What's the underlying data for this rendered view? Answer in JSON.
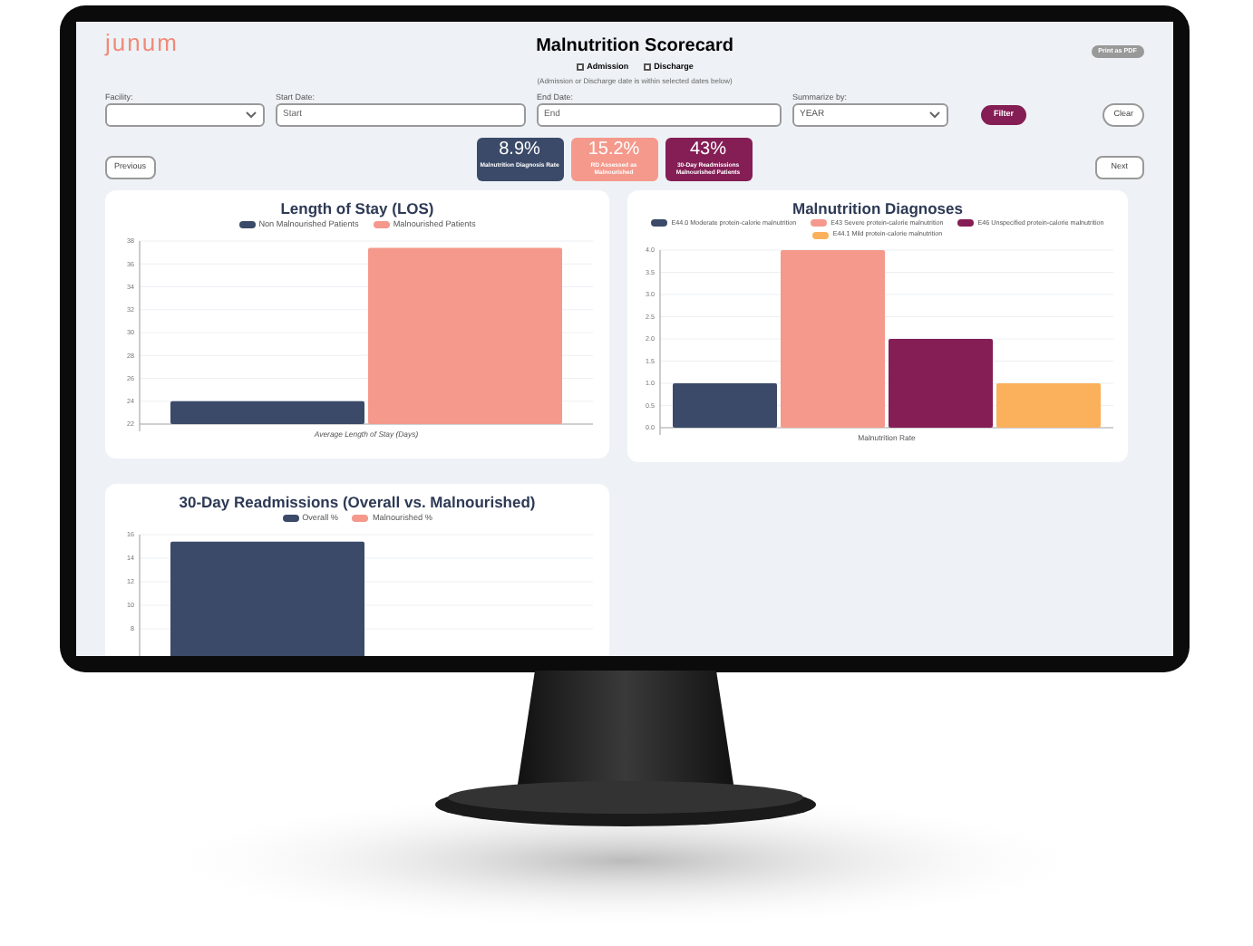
{
  "app": {
    "logo": "junum",
    "title": "Malnutrition Scorecard",
    "print_button": "Print as PDF"
  },
  "date_mode": {
    "options": [
      {
        "label": "Admission",
        "checked": false
      },
      {
        "label": "Discharge",
        "checked": false
      }
    ],
    "note": "(Admission or Discharge date is within selected dates below)"
  },
  "filters": [
    {
      "kind": "select",
      "label": "Facility:"
    },
    {
      "kind": "input",
      "label": "Start Date:",
      "placeholder": "Start"
    },
    {
      "kind": "input",
      "label": "End Date:",
      "placeholder": "End"
    },
    {
      "kind": "select",
      "label": "Summarize by:",
      "value": "YEAR"
    }
  ],
  "filter_button": "Filter",
  "clear_button": "Clear",
  "previous_button": "Previous",
  "next_button": "Next",
  "kpis": [
    {
      "value": "8.9%",
      "label": "Malnutrition Diagnosis Rate",
      "color": "#3b4a68"
    },
    {
      "value": "15.2%",
      "label": "RD Assessed as Malnourished",
      "color": "#f4998c"
    },
    {
      "value": "43%",
      "label": "30-Day Readmissions Malnourished Patients",
      "color": "#841e55"
    }
  ],
  "charts": [
    {
      "title": "Length of Stay (LOS)",
      "chart_data": {
        "type": "bar",
        "categories": [
          "Average Length of Stay (Days)"
        ],
        "ylim": [
          22,
          38
        ],
        "grid": true,
        "yticks": [
          22,
          24,
          26,
          28,
          30,
          32,
          34,
          36,
          38
        ],
        "series": [
          {
            "name": "Non Malnourished Patients",
            "color": "#3b4a68",
            "values": [
              24
            ]
          },
          {
            "name": "Malnourished Patients",
            "color": "#f4998c",
            "values": [
              37.4
            ]
          }
        ]
      }
    },
    {
      "title": "Malnutrition Diagnoses",
      "chart_data": {
        "type": "bar",
        "categories": [
          "Malnutrition Rate"
        ],
        "ylim": [
          0,
          4
        ],
        "grid": true,
        "yticks": [
          {
            "value": 0,
            "label": "0.0"
          },
          0.5,
          {
            "value": 1,
            "label": "1.0"
          },
          1.5,
          {
            "value": 2,
            "label": "2.0"
          },
          2.5,
          {
            "value": 3,
            "label": "3.0"
          },
          3.5,
          {
            "value": 4,
            "label": "4.0"
          }
        ],
        "series": [
          {
            "name": "E44.0 Moderate protein-calorie malnutrition",
            "color": "#3b4a68",
            "values": [
              1
            ]
          },
          {
            "name": "E43 Severe protein-calorie malnutrition",
            "color": "#f4998c",
            "values": [
              4
            ]
          },
          {
            "name": "E46 Unspecified protein-calorie malnutrition",
            "color": "#841e55",
            "values": [
              2
            ]
          },
          {
            "name": "E44.1 Mild protein-calorie malnutrition",
            "color": "#fbb05c",
            "values": [
              1
            ]
          }
        ]
      }
    },
    {
      "title": "30-Day Readmissions (Overall vs. Malnourished)",
      "chart_data": {
        "type": "bar",
        "ylim": [
          0,
          16
        ],
        "grid": true,
        "yticks": [
          8,
          10,
          12,
          14,
          16
        ],
        "series": [
          {
            "name": "Overall %",
            "color": "#3b4a68",
            "values": [
              15.4
            ]
          },
          {
            "name": "Malnourished %",
            "color": "#f4998c",
            "values": [
              null
            ]
          }
        ]
      }
    }
  ]
}
